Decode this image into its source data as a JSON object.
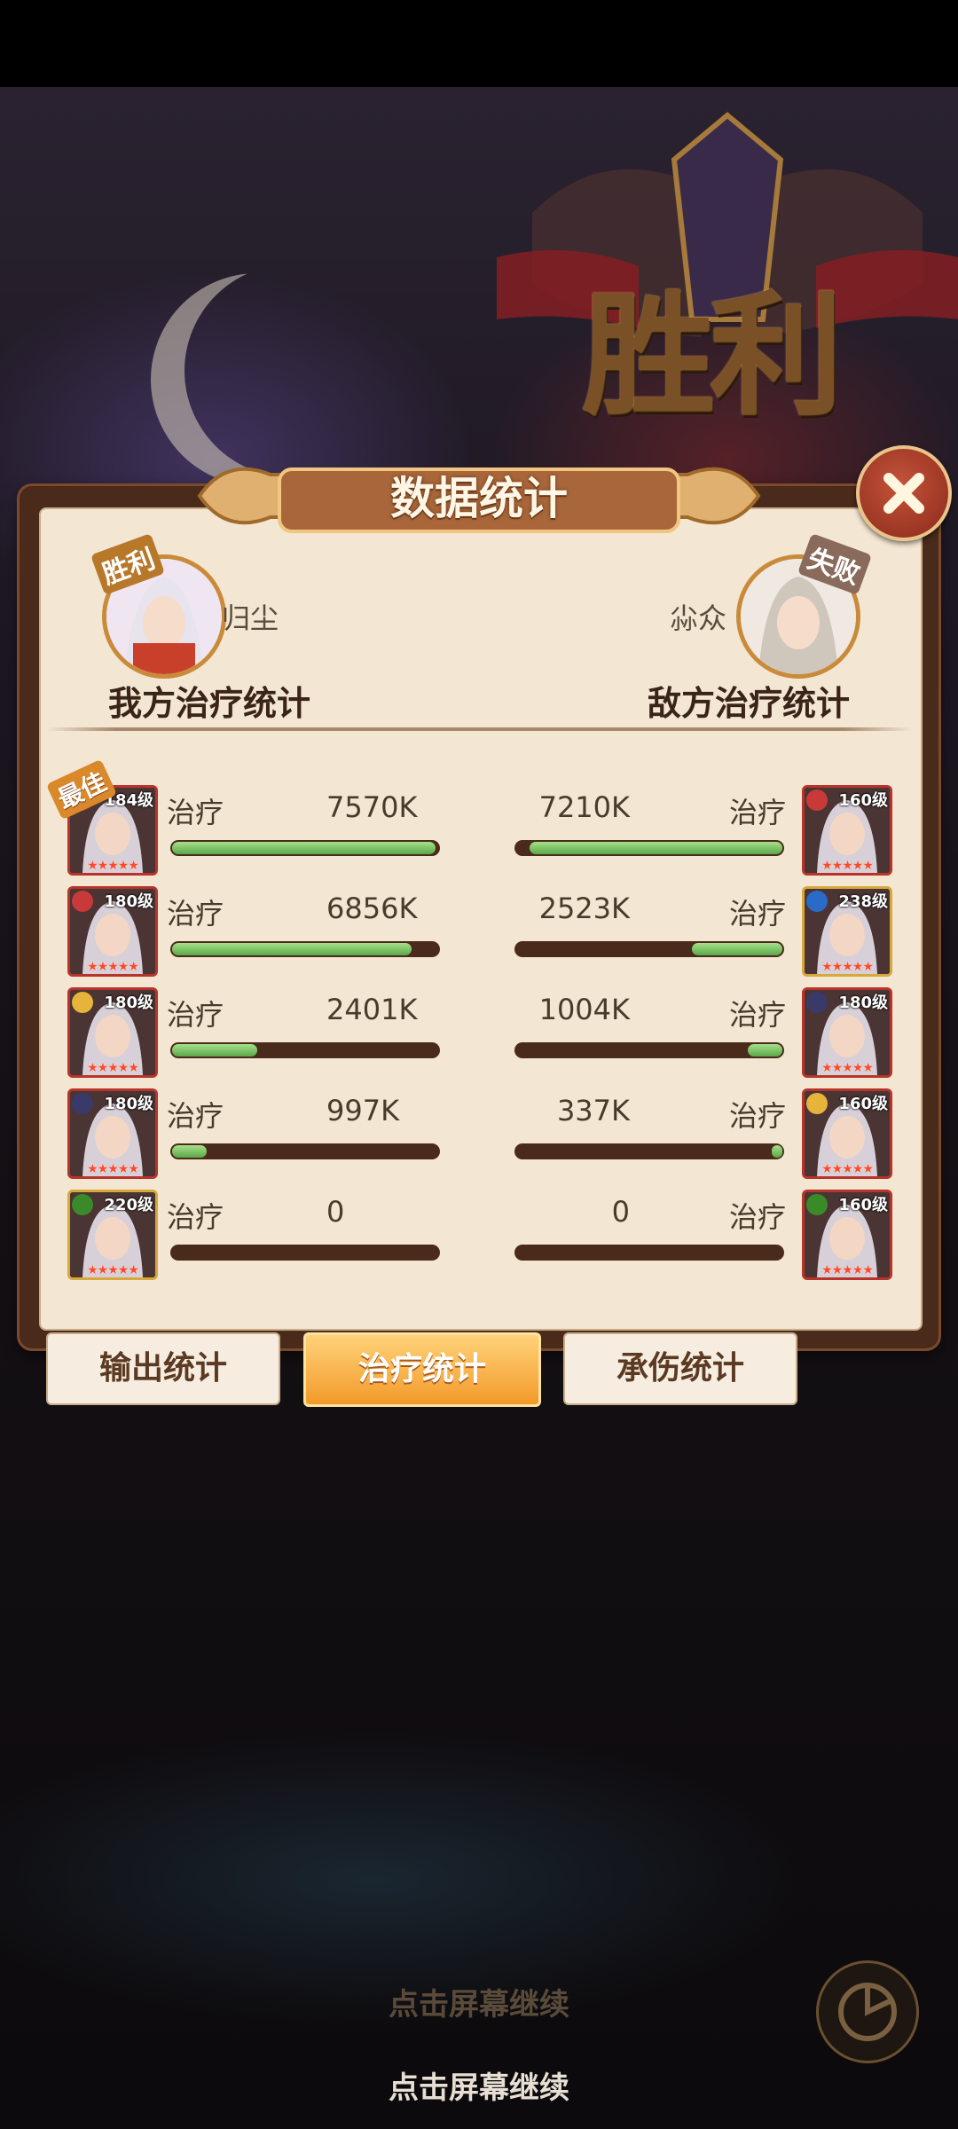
{
  "background": {
    "victory_text": "胜利"
  },
  "panel": {
    "title": "数据统计",
    "close_icon": "close-icon"
  },
  "my_team": {
    "result_badge": "胜利",
    "player_name": "归尘",
    "section_label": "我方治疗统计"
  },
  "enemy_team": {
    "result_badge": "失败",
    "player_name": "尛众",
    "section_label": "敌方治疗统计"
  },
  "best_badge": "最佳",
  "rows": [
    {
      "left": {
        "level": "184级",
        "label": "治疗",
        "value": "7570K",
        "fraction": 0.99,
        "frame": "red",
        "elem": "#7a3a2a"
      },
      "right": {
        "level": "160级",
        "label": "治疗",
        "value": "7210K",
        "fraction": 0.95,
        "frame": "red",
        "elem": "#c83a3a"
      }
    },
    {
      "left": {
        "level": "180级",
        "label": "治疗",
        "value": "6856K",
        "fraction": 0.9,
        "frame": "red",
        "elem": "#c83a3a"
      },
      "right": {
        "level": "238级",
        "label": "治疗",
        "value": "2523K",
        "fraction": 0.34,
        "frame": "gold",
        "elem": "#2a6ac8"
      }
    },
    {
      "left": {
        "level": "180级",
        "label": "治疗",
        "value": "2401K",
        "fraction": 0.32,
        "frame": "red",
        "elem": "#e6b43a"
      },
      "right": {
        "level": "180级",
        "label": "治疗",
        "value": "1004K",
        "fraction": 0.13,
        "frame": "red",
        "elem": "#3a3a6a"
      }
    },
    {
      "left": {
        "level": "180级",
        "label": "治疗",
        "value": "997K",
        "fraction": 0.13,
        "frame": "red",
        "elem": "#3a3a6a"
      },
      "right": {
        "level": "160级",
        "label": "治疗",
        "value": "337K",
        "fraction": 0.04,
        "frame": "red",
        "elem": "#e6b43a"
      }
    },
    {
      "left": {
        "level": "220级",
        "label": "治疗",
        "value": "0",
        "fraction": 0,
        "frame": "gold",
        "elem": "#3a8a2a"
      },
      "right": {
        "level": "160级",
        "label": "治疗",
        "value": "0",
        "fraction": 0,
        "frame": "red",
        "elem": "#3a8a2a"
      }
    }
  ],
  "tabs": [
    {
      "label": "输出统计",
      "active": false
    },
    {
      "label": "治疗统计",
      "active": true
    },
    {
      "label": "承伤统计",
      "active": false
    }
  ],
  "continue_text": "点击屏幕继续",
  "stars": "★★★★★"
}
